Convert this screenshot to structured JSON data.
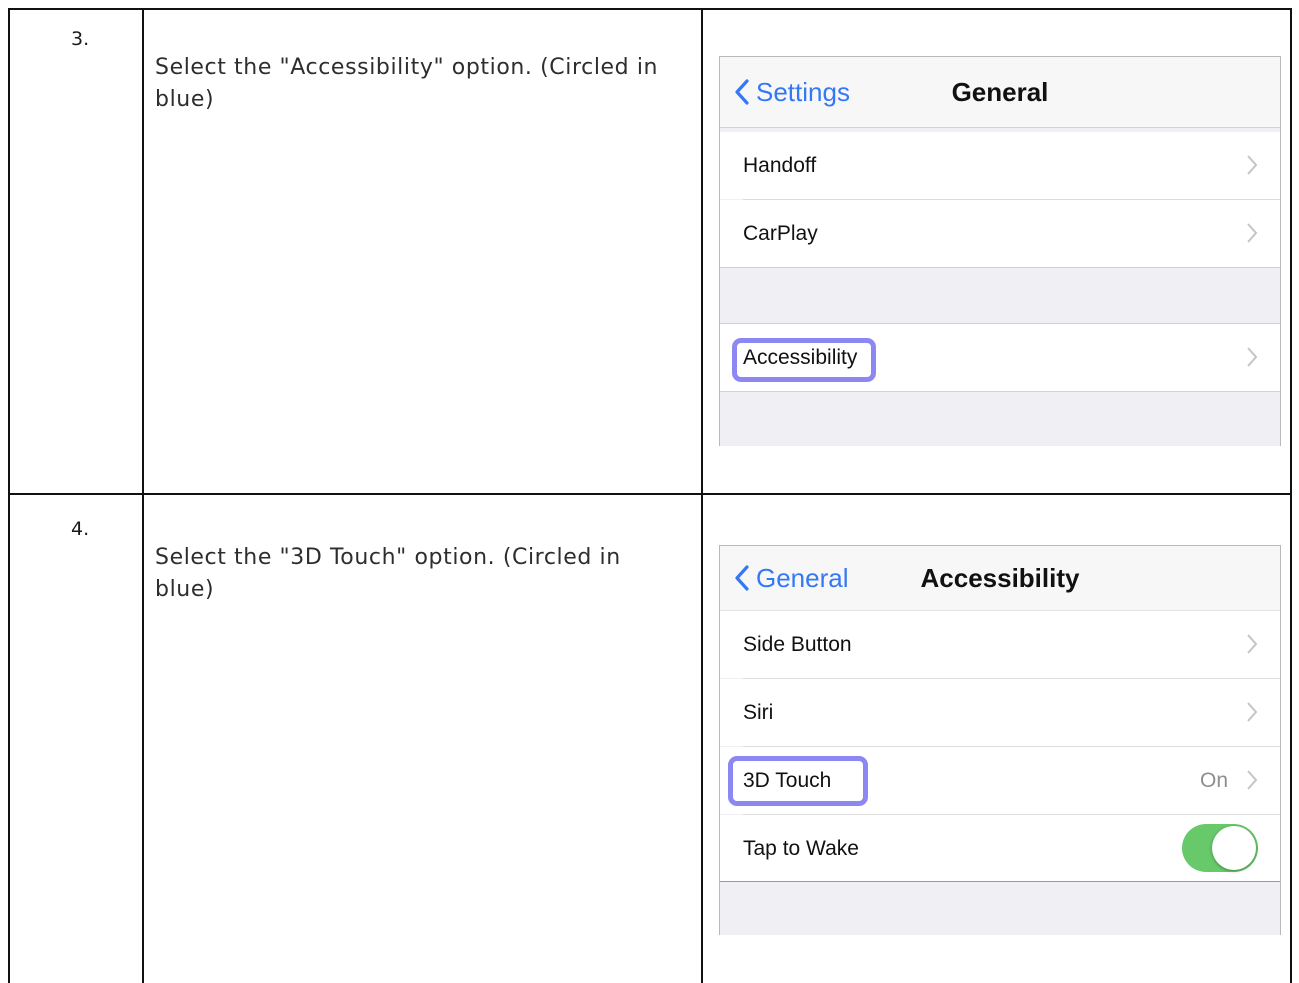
{
  "steps": [
    {
      "number": "3.",
      "instruction": "Select the \"Accessibility\" option. (Circled in blue)",
      "screen": {
        "back_label": "Settings",
        "title": "General",
        "rows": [
          {
            "label": "Handoff"
          },
          {
            "label": "CarPlay"
          },
          {
            "label": "Accessibility"
          }
        ]
      }
    },
    {
      "number": "4.",
      "instruction": "Select the \"3D Touch\" option. (Circled in blue)",
      "screen": {
        "back_label": "General",
        "title": "Accessibility",
        "rows": [
          {
            "label": "Side Button"
          },
          {
            "label": "Siri"
          },
          {
            "label": "3D Touch",
            "detail": "On"
          },
          {
            "label": "Tap to Wake",
            "toggle": "on"
          }
        ]
      }
    }
  ],
  "colors": {
    "ios_blue": "#3478f6",
    "highlight": "#8c87f2",
    "toggle_on": "#67c96a"
  },
  "icons": [
    "chevron-left-icon",
    "chevron-right-icon"
  ]
}
